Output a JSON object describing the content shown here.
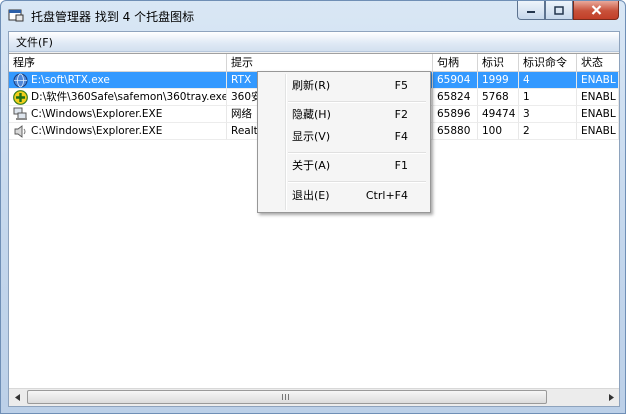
{
  "window": {
    "title": "托盘管理器  找到 4 个托盘图标"
  },
  "menubar": {
    "file": "文件(F)"
  },
  "columns": [
    "程序",
    "提示",
    "句柄",
    "标识",
    "标识命令",
    "状态"
  ],
  "rows": [
    {
      "program": "E:\\soft\\RTX.exe",
      "tip": "RTX",
      "handle": "65904",
      "id": "1999",
      "cmd": "4",
      "status": "ENABL",
      "icon": "rtx-globe-icon",
      "selected": true
    },
    {
      "program": "D:\\软件\\360Safe\\safemon\\360tray.exe",
      "tip": "360安",
      "handle": "65824",
      "id": "5768",
      "cmd": "1",
      "status": "ENABL",
      "icon": "360-safe-icon",
      "selected": false
    },
    {
      "program": "C:\\Windows\\Explorer.EXE",
      "tip": "网络",
      "handle": "65896",
      "id": "49474",
      "cmd": "3",
      "status": "ENABL",
      "icon": "network-icon",
      "selected": false
    },
    {
      "program": "C:\\Windows\\Explorer.EXE",
      "tip": "Realt",
      "handle": "65880",
      "id": "100",
      "cmd": "2",
      "status": "ENABL",
      "icon": "speaker-icon",
      "selected": false
    }
  ],
  "context_menu": {
    "refresh": {
      "label": "刷新(R)",
      "shortcut": "F5"
    },
    "hide": {
      "label": "隐藏(H)",
      "shortcut": "F2"
    },
    "show": {
      "label": "显示(V)",
      "shortcut": "F4"
    },
    "about": {
      "label": "关于(A)",
      "shortcut": "F1"
    },
    "exit": {
      "label": "退出(E)",
      "shortcut": "Ctrl+F4"
    }
  },
  "colors": {
    "selection": "#3399ff",
    "close_button": "#c8513a",
    "titlebar": "#c3d6ec"
  }
}
